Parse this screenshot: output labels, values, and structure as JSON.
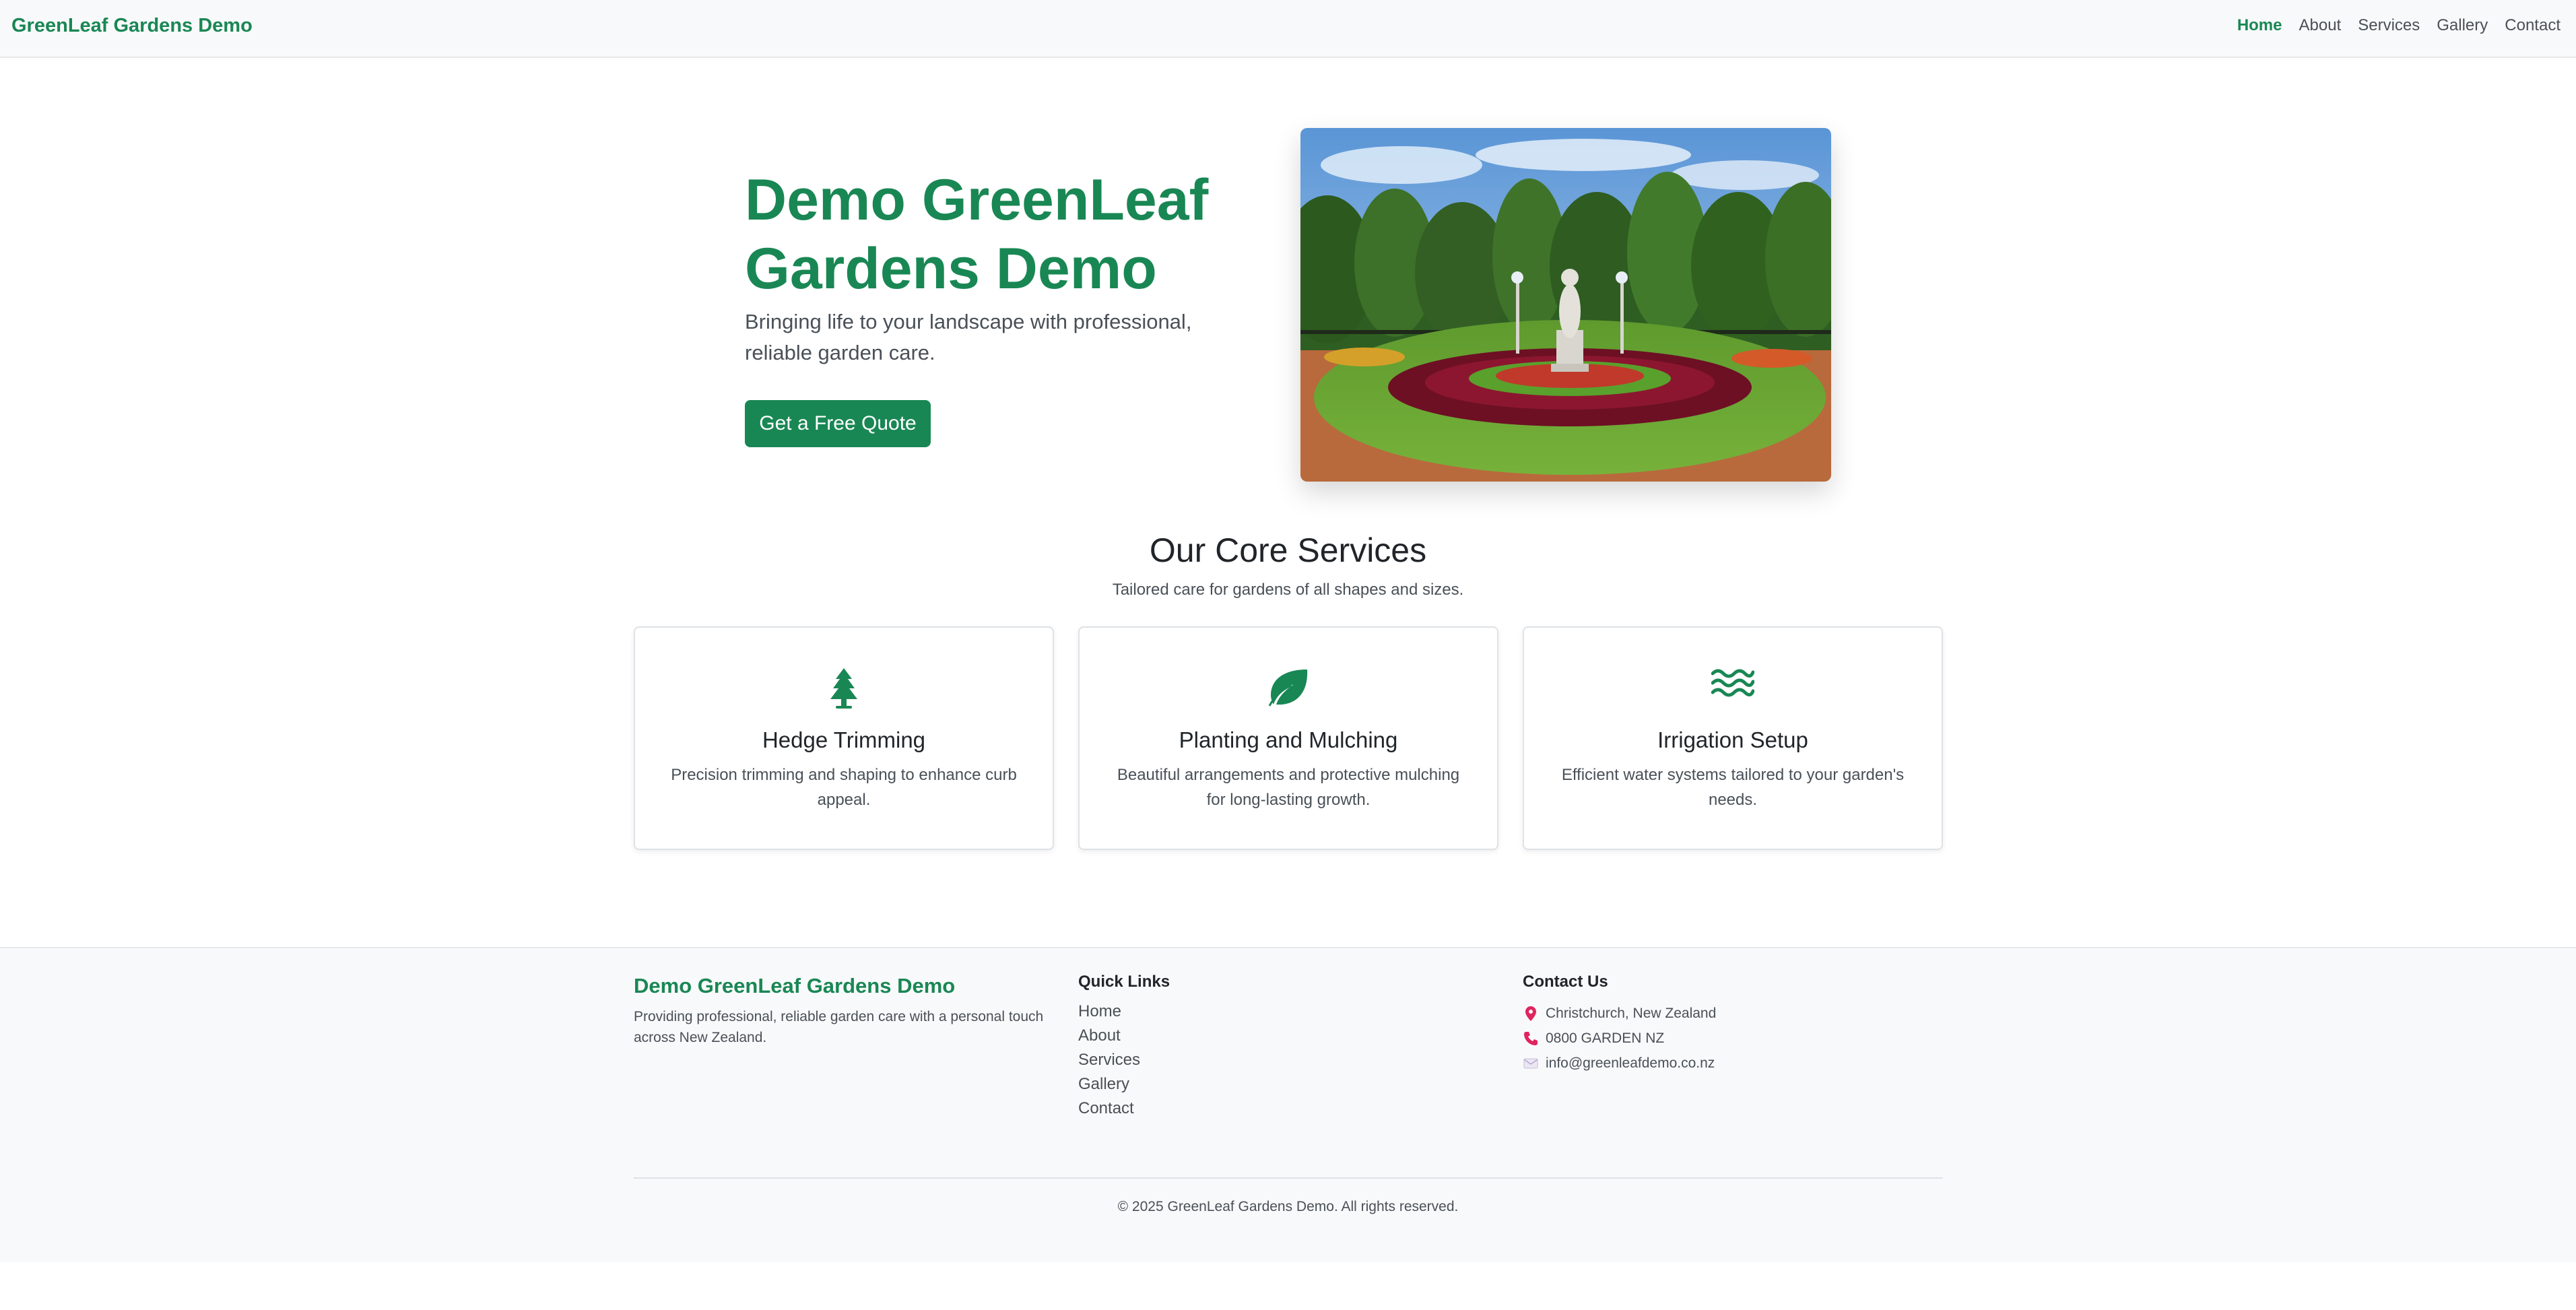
{
  "navbar": {
    "brand": "GreenLeaf Gardens Demo",
    "links": [
      "Home",
      "About",
      "Services",
      "Gallery",
      "Contact"
    ],
    "active": "Home"
  },
  "hero": {
    "title": "Demo GreenLeaf Gardens Demo",
    "subtitle": "Bringing life to your landscape with professional, reliable garden care.",
    "cta_label": "Get a Free Quote",
    "image_icon": "garden-statue-photo"
  },
  "services": {
    "title": "Our Core Services",
    "subtitle": "Tailored care for gardens of all shapes and sizes.",
    "cards": [
      {
        "icon": "tree-icon",
        "title": "Hedge Trimming",
        "description": "Precision trimming and shaping to enhance curb appeal."
      },
      {
        "icon": "leaf-icon",
        "title": "Planting and Mulching",
        "description": "Beautiful arrangements and protective mulching for long-lasting growth."
      },
      {
        "icon": "water-icon",
        "title": "Irrigation Setup",
        "description": "Efficient water systems tailored to your garden's needs."
      }
    ]
  },
  "footer": {
    "brand": "Demo GreenLeaf Gardens Demo",
    "description": "Providing professional, reliable garden care with a personal touch across New Zealand.",
    "quick_links_title": "Quick Links",
    "quick_links": [
      "Home",
      "About",
      "Services",
      "Gallery",
      "Contact"
    ],
    "contact_title": "Contact Us",
    "contact": [
      {
        "icon": "pin-icon",
        "text": "Christchurch, New Zealand"
      },
      {
        "icon": "phone-icon",
        "text": "0800 GARDEN NZ"
      },
      {
        "icon": "envelope-icon",
        "text": "info@greenleafdemo.co.nz"
      }
    ],
    "copyright": "© 2025 GreenLeaf Gardens Demo. All rights reserved."
  },
  "colors": {
    "brand_green": "#198754",
    "light_bg": "#f8f9fa",
    "muted_text": "#495057"
  }
}
